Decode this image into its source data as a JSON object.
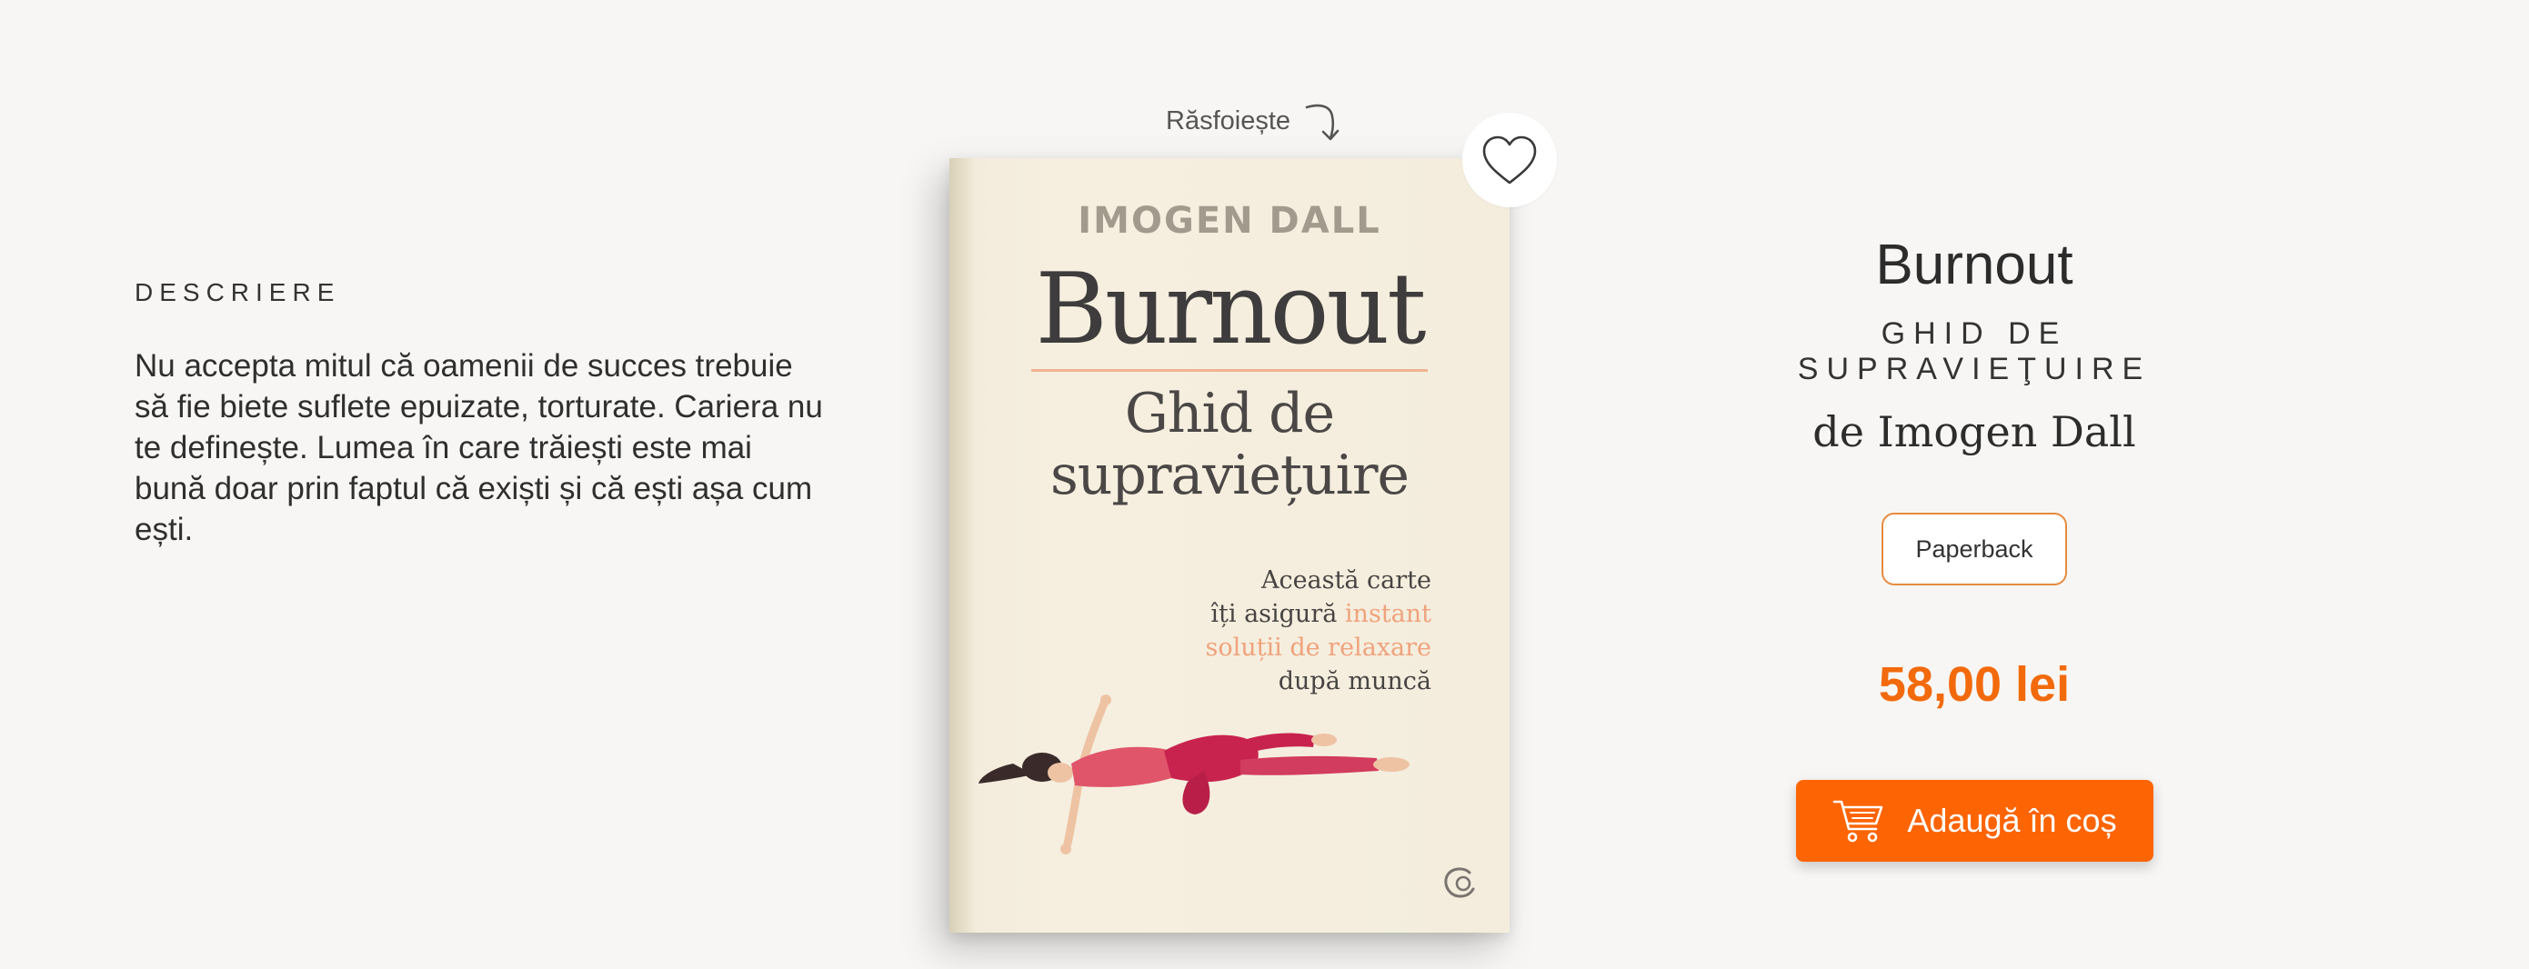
{
  "description": {
    "heading": "DESCRIERE",
    "text": "Nu accepta mitul că oamenii de succes trebuie să fie biete suflete epuizate, torturate. Cariera nu te definește. Lumea în care trăiești este mai bună doar prin faptul că exiști și că ești așa cum ești."
  },
  "browse": {
    "label": "Răsfoiește",
    "icon": "curved-arrow-down-icon"
  },
  "favorite": {
    "icon": "heart-icon"
  },
  "cover": {
    "author": "IMOGEN DALL",
    "title": "Burnout",
    "subtitle_line1": "Ghid de",
    "subtitle_line2": "supraviețuire",
    "tagline_line1": "Această carte",
    "tagline_line2_plain": "îți asigură ",
    "tagline_line2_accent": "instant",
    "tagline_line3_accent": "soluții de relaxare",
    "tagline_line4": "după muncă",
    "accent_color": "#f0a27d"
  },
  "product": {
    "title": "Burnout",
    "subtitle": "GHID DE SUPRAVIEŢUIRE",
    "author": "de Imogen Dall",
    "format": "Paperback",
    "price": "58,00 lei",
    "price_color": "#f26a0c",
    "add_to_cart_label": "Adaugă în coș",
    "add_to_cart_icon": "shopping-cart-icon",
    "button_color": "#fd6404"
  }
}
